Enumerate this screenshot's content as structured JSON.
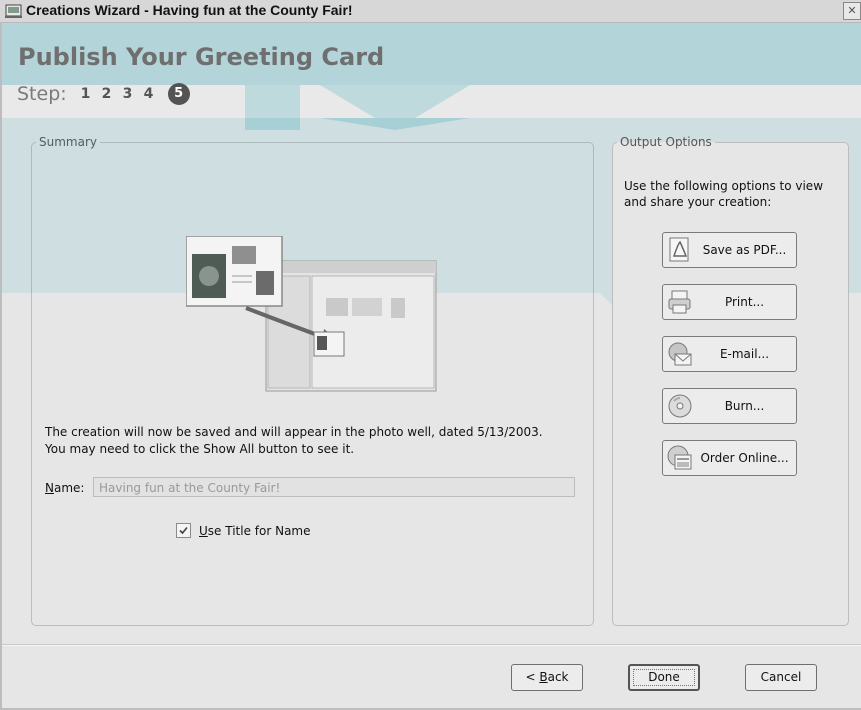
{
  "window": {
    "title": "Creations Wizard - Having fun at the County Fair!",
    "close_glyph": "✕"
  },
  "header": {
    "heading": "Publish Your Greeting Card",
    "step_label": "Step:",
    "steps": [
      "1",
      "2",
      "3",
      "4",
      "5"
    ],
    "current_step": "5"
  },
  "summary": {
    "legend": "Summary",
    "message_line1": "The creation will now be saved and will appear in the photo well, dated 5/13/2003.",
    "message_line2": "You may need to click the Show All button to see it.",
    "name_label_key": "N",
    "name_label_rest": "ame:",
    "name_value": "Having fun at the County Fair!",
    "checkbox_key": "U",
    "checkbox_rest": "se Title for Name",
    "checkbox_checked": true
  },
  "output_options": {
    "legend": "Output Options",
    "description": "Use the following options to view and share your creation:",
    "buttons": [
      {
        "label": "Save as PDF...",
        "icon": "pdf-icon"
      },
      {
        "label": "Print...",
        "icon": "printer-icon"
      },
      {
        "label": "E-mail...",
        "icon": "email-icon"
      },
      {
        "label": "Burn...",
        "icon": "cd-icon"
      },
      {
        "label": "Order Online...",
        "icon": "online-icon"
      }
    ]
  },
  "footer": {
    "back_prefix": "< ",
    "back_key": "B",
    "back_rest": "ack",
    "done": "Done",
    "cancel": "Cancel"
  },
  "colors": {
    "watermark": "#2aa6b3",
    "background": "#e6e6e6",
    "group_border": "#bdbdbd"
  }
}
